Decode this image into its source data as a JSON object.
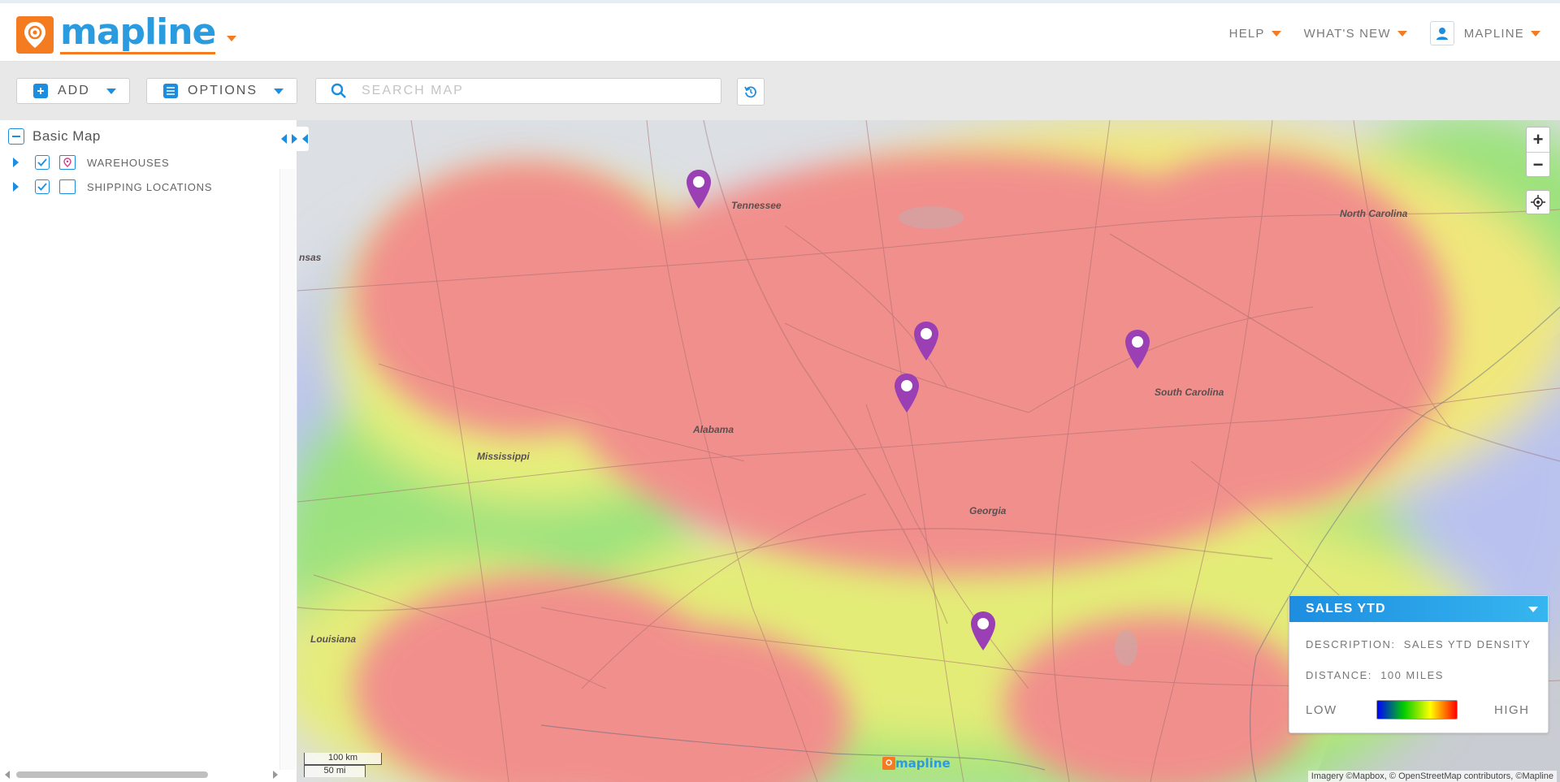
{
  "brand": {
    "name": "mapline",
    "accent": "#f47b20",
    "primary": "#1d8de0"
  },
  "topnav": {
    "help": "HELP",
    "whats_new": "WHAT'S NEW",
    "user": "MAPLINE"
  },
  "toolbar": {
    "add_label": "ADD",
    "options_label": "OPTIONS",
    "search_placeholder": "SEARCH MAP"
  },
  "sidebar": {
    "map_title": "Basic Map",
    "layers": [
      {
        "label": "WAREHOUSES",
        "checked": true,
        "icon": "map-pin-icon"
      },
      {
        "label": "SHIPPING LOCATIONS",
        "checked": true,
        "icon": "folder-icon"
      }
    ]
  },
  "map": {
    "state_labels": [
      "Tennessee",
      "North Carolina",
      "South Carolina",
      "Alabama",
      "Mississippi",
      "Georgia",
      "Louisiana",
      "nsas"
    ],
    "pin_color": "#9b3fb5",
    "scale": {
      "km": "100 km",
      "mi": "50 mi"
    },
    "attribution": "Imagery ©Mapbox, © OpenStreetMap contributors, ©Mapline",
    "watermark": "mapline"
  },
  "legend": {
    "title": "SALES YTD",
    "description_label": "DESCRIPTION:",
    "description_value": "SALES YTD DENSITY",
    "distance_label": "DISTANCE:",
    "distance_value": "100 MILES",
    "low": "LOW",
    "high": "HIGH"
  }
}
